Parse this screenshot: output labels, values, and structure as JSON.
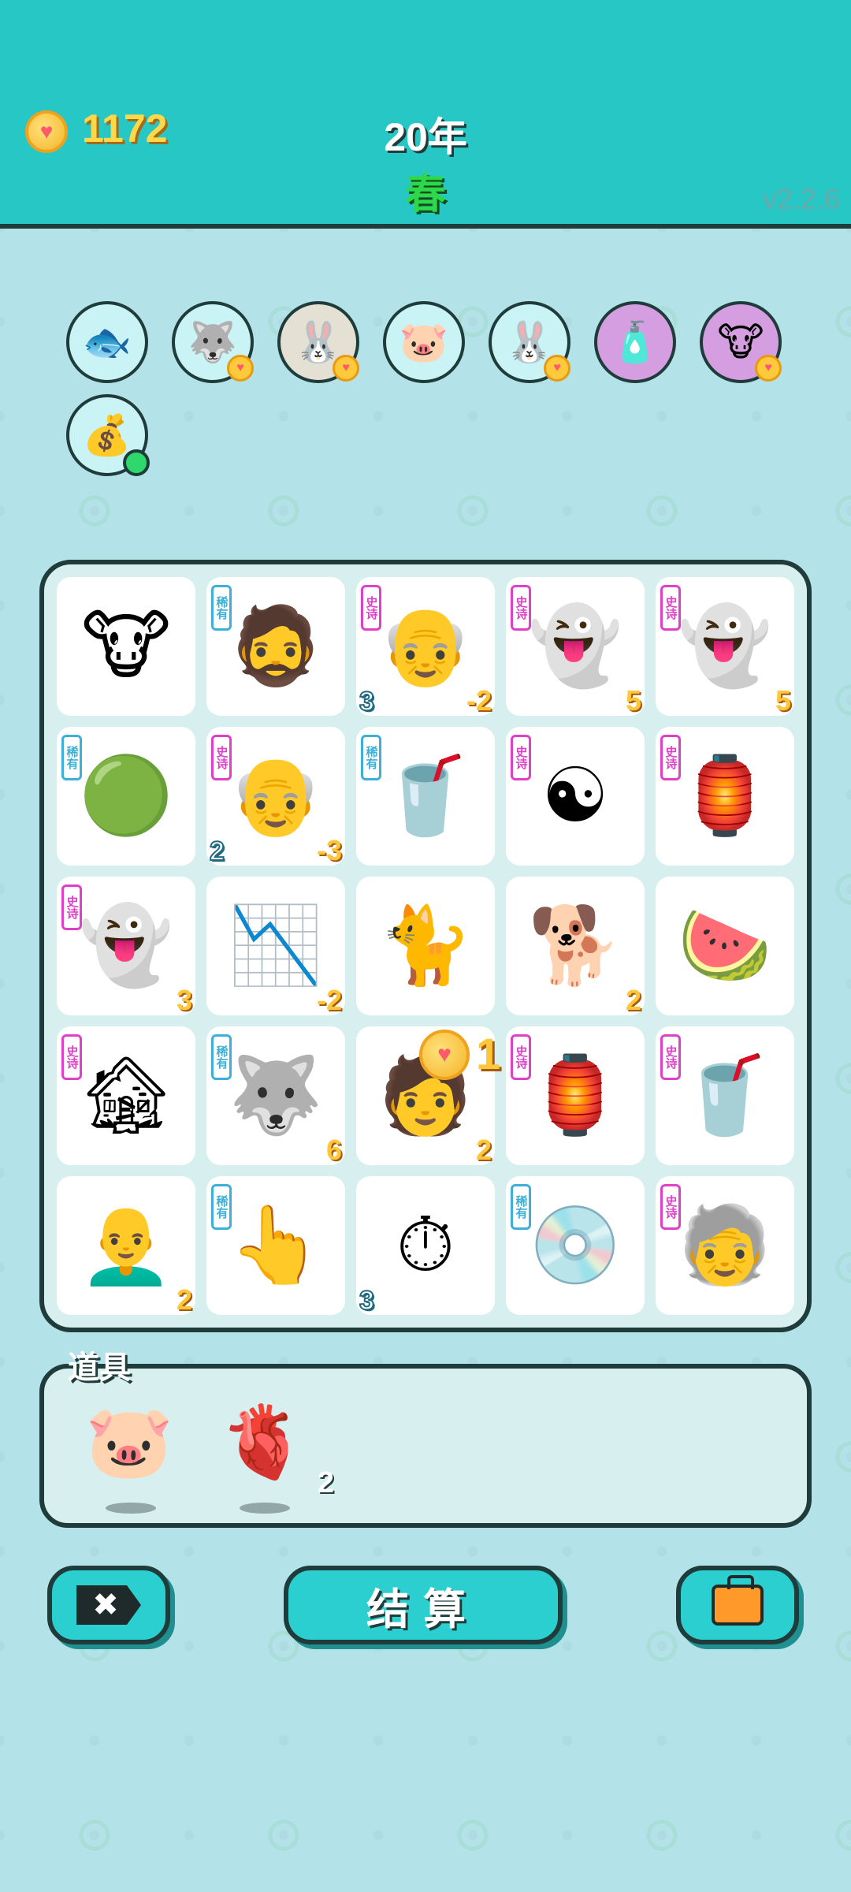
{
  "header": {
    "coins": "1172",
    "year": "20年",
    "season": "春",
    "version": "v2.2.6"
  },
  "upgrades": [
    {
      "icon": "fishbowl-icon",
      "glyph": "🐟",
      "bg": "#c9f3f5",
      "badge": false
    },
    {
      "icon": "husky-upgrade-icon",
      "glyph": "🐺",
      "bg": "#c9f3f5",
      "badge": true
    },
    {
      "icon": "rabbit-upgrade-icon",
      "glyph": "🐰",
      "bg": "#e5e0d4",
      "badge": true
    },
    {
      "icon": "piggy-bank-upgrade-icon",
      "glyph": "🐷",
      "bg": "#c9f3f5",
      "badge": false
    },
    {
      "icon": "rabbit-upgrade-icon-2",
      "glyph": "🐰",
      "bg": "#c9f3f5",
      "badge": true
    },
    {
      "icon": "spray-bottle-icon",
      "glyph": "🧴",
      "bg": "#d59ee0",
      "badge": false
    },
    {
      "icon": "cow-pair-icon",
      "glyph": "🐮",
      "bg": "#d59ee0",
      "badge": true
    },
    {
      "icon": "money-bag-icon",
      "glyph": "💰",
      "bg": "#c9f3f5",
      "dot": true
    }
  ],
  "grid": [
    {
      "name": "cow",
      "glyph": "🐮",
      "tag": "",
      "tag_type": "",
      "value": "",
      "left_value": ""
    },
    {
      "name": "bucket-hat-man",
      "glyph": "🧔",
      "tag": "稀有",
      "tag_type": "rare",
      "value": "",
      "left_value": ""
    },
    {
      "name": "old-man",
      "glyph": "👴",
      "tag": "史诗",
      "tag_type": "epic",
      "value": "-2",
      "left_value": "3"
    },
    {
      "name": "ghost",
      "glyph": "👻",
      "tag": "史诗",
      "tag_type": "epic",
      "value": "5",
      "left_value": ""
    },
    {
      "name": "ghost",
      "glyph": "👻",
      "tag": "史诗",
      "tag_type": "epic",
      "value": "5",
      "left_value": ""
    },
    {
      "name": "wood-element",
      "glyph": "🟢",
      "tag": "稀有",
      "tag_type": "rare",
      "value": "",
      "left_value": ""
    },
    {
      "name": "old-man",
      "glyph": "👴",
      "tag": "史诗",
      "tag_type": "epic",
      "value": "-3",
      "left_value": "2"
    },
    {
      "name": "milk-tea",
      "glyph": "🥤",
      "tag": "稀有",
      "tag_type": "rare",
      "value": "",
      "left_value": ""
    },
    {
      "name": "bagua-mirror",
      "glyph": "☯",
      "tag": "史诗",
      "tag_type": "epic",
      "value": "",
      "left_value": ""
    },
    {
      "name": "rabbit-hutch",
      "glyph": "🏮",
      "tag": "史诗",
      "tag_type": "epic",
      "value": "",
      "left_value": ""
    },
    {
      "name": "ghost",
      "glyph": "👻",
      "tag": "史诗",
      "tag_type": "epic",
      "value": "3",
      "left_value": ""
    },
    {
      "name": "stock-chart",
      "glyph": "📉",
      "tag": "",
      "tag_type": "",
      "value": "-2",
      "left_value": ""
    },
    {
      "name": "cat",
      "glyph": "🐈",
      "tag": "",
      "tag_type": "",
      "value": "",
      "left_value": ""
    },
    {
      "name": "dog",
      "glyph": "🐕",
      "tag": "",
      "tag_type": "",
      "value": "2",
      "left_value": ""
    },
    {
      "name": "watermelon",
      "glyph": "🍉",
      "tag": "",
      "tag_type": "",
      "value": "",
      "left_value": ""
    },
    {
      "name": "haunted-house",
      "glyph": "🏚",
      "tag": "史诗",
      "tag_type": "epic",
      "value": "",
      "left_value": ""
    },
    {
      "name": "husky",
      "glyph": "🐺",
      "tag": "稀有",
      "tag_type": "rare",
      "value": "6",
      "left_value": ""
    },
    {
      "name": "man-face",
      "glyph": "🧑",
      "tag": "",
      "tag_type": "",
      "value": "2",
      "left_value": ""
    },
    {
      "name": "rabbit-hutch",
      "glyph": "🏮",
      "tag": "史诗",
      "tag_type": "epic",
      "value": "",
      "left_value": ""
    },
    {
      "name": "milk-tea",
      "glyph": "🥤",
      "tag": "史诗",
      "tag_type": "epic",
      "value": "",
      "left_value": ""
    },
    {
      "name": "bald-man",
      "glyph": "👨‍🦲",
      "tag": "",
      "tag_type": "",
      "value": "2",
      "left_value": ""
    },
    {
      "name": "pointing-finger",
      "glyph": "👆",
      "tag": "稀有",
      "tag_type": "rare",
      "value": "",
      "left_value": ""
    },
    {
      "name": "stopwatch-card",
      "glyph": "⏱",
      "tag": "",
      "tag_type": "",
      "value": "",
      "left_value": "3"
    },
    {
      "name": "ghost-cd",
      "glyph": "💿",
      "tag": "稀有",
      "tag_type": "rare",
      "value": "",
      "left_value": ""
    },
    {
      "name": "green-hat-man",
      "glyph": "🧓",
      "tag": "史诗",
      "tag_type": "epic",
      "value": "",
      "left_value": ""
    }
  ],
  "float_reward": "1",
  "items_label": "道具",
  "items": [
    {
      "name": "piggy-bank",
      "glyph": "🐷",
      "count": ""
    },
    {
      "name": "liver",
      "glyph": "🫀",
      "count": "2"
    }
  ],
  "buttons": {
    "close_glyph": "✖",
    "settle_label": "结算"
  }
}
